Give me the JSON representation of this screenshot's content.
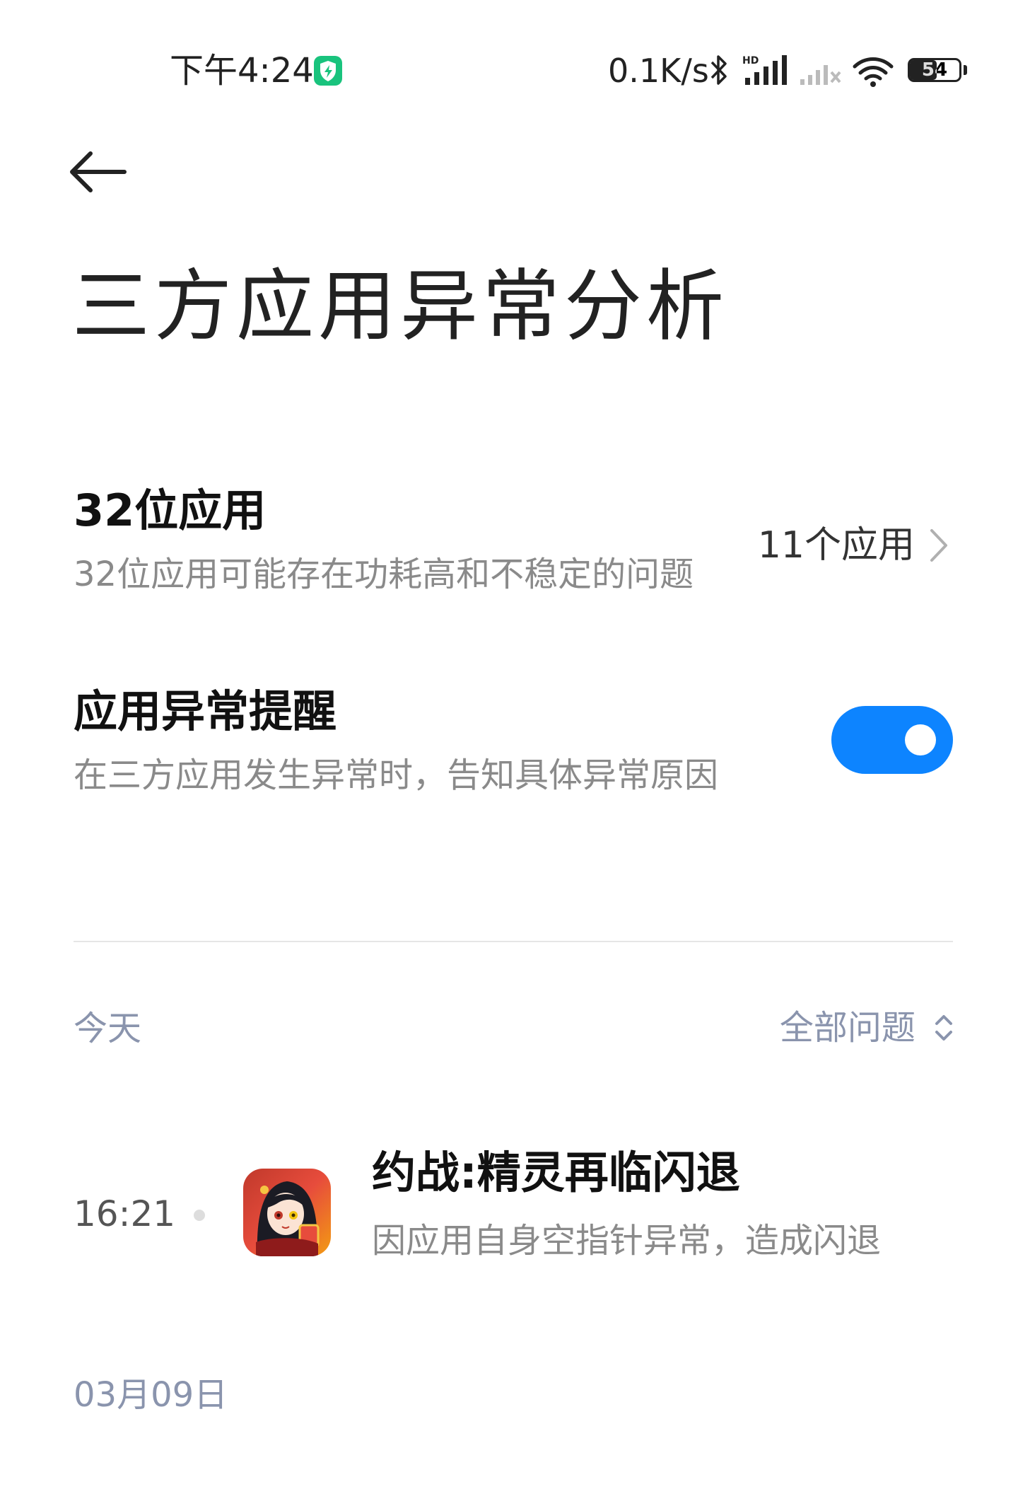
{
  "status_bar": {
    "time": "下午4:24",
    "net_speed": "0.1K/s",
    "hd_label": "HD",
    "battery": "54",
    "icons": [
      "shield-icon",
      "bluetooth-icon",
      "signal-icon",
      "signal-no-service-icon",
      "wifi-icon",
      "battery-icon"
    ],
    "accent_color": "#19c37d"
  },
  "header": {
    "back_icon": "back-arrow-icon",
    "title": "三方应用异常分析"
  },
  "settings": {
    "apps_32bit": {
      "title": "32位应用",
      "subtitle": "32位应用可能存在功耗高和不稳定的问题",
      "value": "11个应用"
    },
    "anomaly_alert": {
      "title": "应用异常提醒",
      "subtitle": "在三方应用发生异常时，告知具体异常原因",
      "enabled": true,
      "toggle_color": "#0d84ff"
    }
  },
  "list": {
    "today_label": "今天",
    "filter_label": "全部问题",
    "items": [
      {
        "time": "16:21",
        "title": "约战:精灵再临闪退",
        "subtitle": "因应用自身空指针异常，造成闪退"
      }
    ],
    "next_date_label": "03月09日"
  }
}
